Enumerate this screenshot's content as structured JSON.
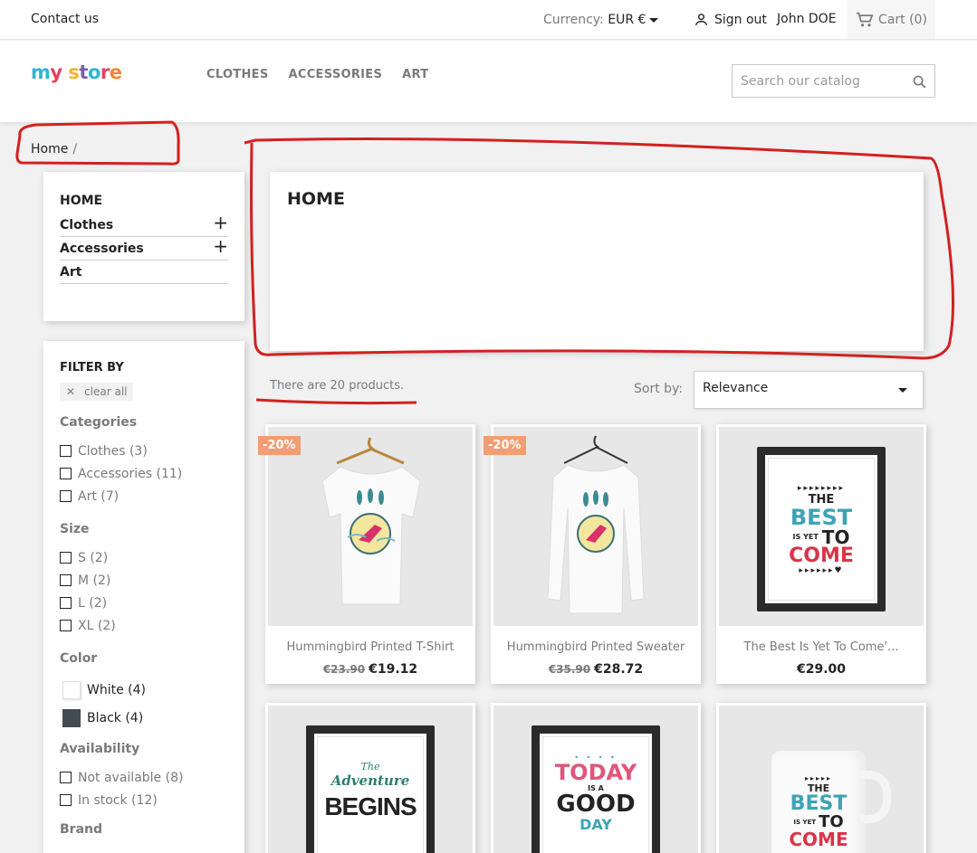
{
  "topnav": {
    "contact": "Contact us",
    "currency_label": "Currency:",
    "currency_value": "EUR €",
    "signout": "Sign out",
    "user": "John DOE",
    "cart": "Cart (0)"
  },
  "header": {
    "logo": "my store",
    "menu": [
      "CLOTHES",
      "ACCESSORIES",
      "ART"
    ],
    "search_placeholder": "Search our catalog"
  },
  "breadcrumb": {
    "home": "Home",
    "separator": "/"
  },
  "categories": {
    "title": "HOME",
    "items": [
      {
        "label": "Clothes",
        "expander": "+"
      },
      {
        "label": "Accessories",
        "expander": "+"
      },
      {
        "label": "Art",
        "expander": ""
      }
    ]
  },
  "filters": {
    "title": "FILTER BY",
    "clear_all": "clear all",
    "categories_title": "Categories",
    "categories": [
      "Clothes (3)",
      "Accessories (11)",
      "Art (7)"
    ],
    "size_title": "Size",
    "sizes": [
      "S (2)",
      "M (2)",
      "L (2)",
      "XL (2)"
    ],
    "color_title": "Color",
    "colors": [
      {
        "label": "White (4)",
        "hex": "#ffffff"
      },
      {
        "label": "Black (4)",
        "hex": "#434a54"
      }
    ],
    "availability_title": "Availability",
    "availability": [
      "Not available (8)",
      "In stock (12)"
    ],
    "brand_title": "Brand"
  },
  "hero": {
    "title": "HOME"
  },
  "listing": {
    "count": "There are 20 products.",
    "sort_label": "Sort by:",
    "sort_value": "Relevance"
  },
  "products": [
    {
      "badge": "-20%",
      "name": "Hummingbird Printed T-Shirt",
      "old_price": "€23.90",
      "price": "€19.12"
    },
    {
      "badge": "-20%",
      "name": "Hummingbird Printed Sweater",
      "old_price": "€35.90",
      "price": "€28.72"
    },
    {
      "badge": "",
      "name": "The Best Is Yet To Come'...",
      "old_price": "",
      "price": "€29.00"
    }
  ],
  "poster_text": {
    "best": [
      "THE",
      "BEST",
      "IS YET",
      "TO",
      "COME"
    ],
    "adventure": [
      "The",
      "Adventure",
      "BEGINS"
    ],
    "today": [
      "TODAY",
      "IS A",
      "GOOD",
      "DAY"
    ],
    "mug": [
      "THE",
      "BEST",
      "IS YET",
      "TO",
      "COME"
    ]
  },
  "colors": {
    "accent": "#2fb5d2",
    "badge": "#f39d72",
    "annotation": "#d42020"
  }
}
